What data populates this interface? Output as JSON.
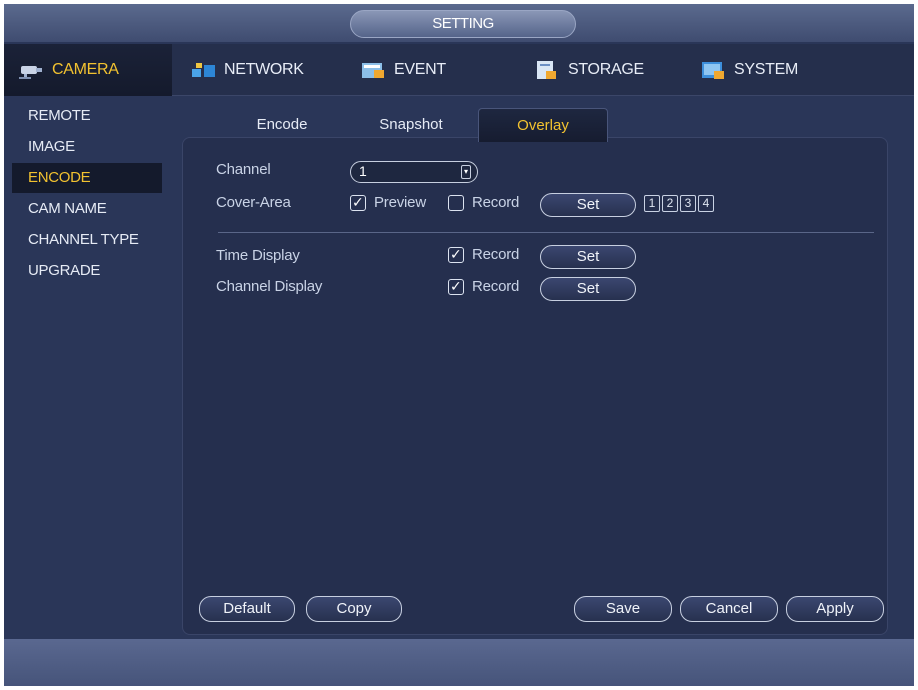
{
  "window": {
    "title": "SETTING"
  },
  "main_tabs": [
    {
      "label": "CAMERA",
      "icon": "camera-icon",
      "active": true
    },
    {
      "label": "NETWORK",
      "icon": "network-icon",
      "active": false
    },
    {
      "label": "EVENT",
      "icon": "event-icon",
      "active": false
    },
    {
      "label": "STORAGE",
      "icon": "storage-icon",
      "active": false
    },
    {
      "label": "SYSTEM",
      "icon": "system-icon",
      "active": false
    }
  ],
  "sidebar": {
    "items": [
      {
        "label": "REMOTE",
        "active": false
      },
      {
        "label": "IMAGE",
        "active": false
      },
      {
        "label": "ENCODE",
        "active": true
      },
      {
        "label": "CAM NAME",
        "active": false
      },
      {
        "label": "CHANNEL TYPE",
        "active": false
      },
      {
        "label": "UPGRADE",
        "active": false
      }
    ]
  },
  "sub_tabs": [
    {
      "label": "Encode",
      "active": false
    },
    {
      "label": "Snapshot",
      "active": false
    },
    {
      "label": "Overlay",
      "active": true
    }
  ],
  "overlay": {
    "channel": {
      "label": "Channel",
      "value": "1"
    },
    "cover_area": {
      "label": "Cover-Area",
      "preview_label": "Preview",
      "preview_checked": true,
      "record_label": "Record",
      "record_checked": false,
      "set_label": "Set",
      "regions": [
        "1",
        "2",
        "3",
        "4"
      ]
    },
    "time_display": {
      "label": "Time Display",
      "record_label": "Record",
      "record_checked": true,
      "set_label": "Set"
    },
    "channel_display": {
      "label": "Channel Display",
      "record_label": "Record",
      "record_checked": true,
      "set_label": "Set"
    }
  },
  "footer_buttons": {
    "default": "Default",
    "copy": "Copy",
    "save": "Save",
    "cancel": "Cancel",
    "apply": "Apply"
  },
  "colors": {
    "accent": "#f2c230",
    "background": "#2a3658",
    "panel": "#252f4e"
  }
}
